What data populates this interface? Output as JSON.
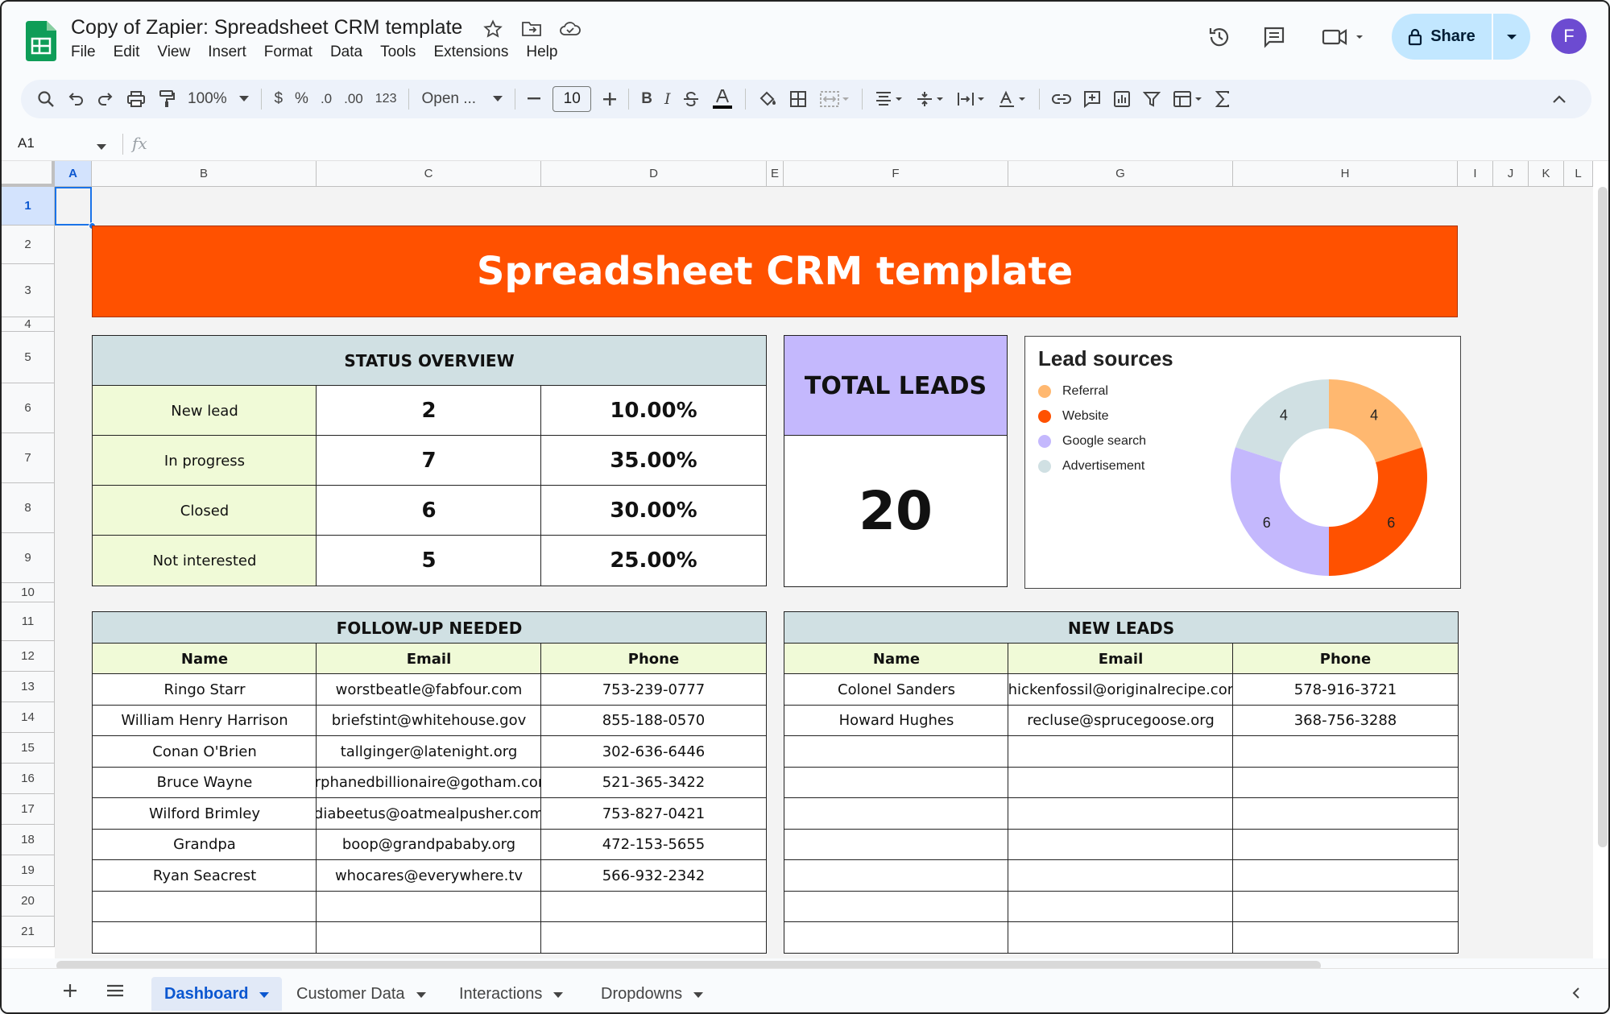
{
  "app": {
    "doc_title": "Copy of Zapier: Spreadsheet CRM template",
    "menu": [
      "File",
      "Edit",
      "View",
      "Insert",
      "Format",
      "Data",
      "Tools",
      "Extensions",
      "Help"
    ],
    "share_label": "Share",
    "avatar_letter": "F"
  },
  "toolbar": {
    "zoom": "100%",
    "currency": "$",
    "percent": "%",
    "dec_decrease": ".0",
    "dec_increase": ".00",
    "number_format": "123",
    "font": "Open ...",
    "font_size": "10",
    "bold": "B",
    "italic": "I"
  },
  "formula_bar": {
    "cell_ref": "A1",
    "fx": "fx",
    "content": ""
  },
  "columns": [
    "A",
    "B",
    "C",
    "D",
    "E",
    "F",
    "G",
    "H",
    "I",
    "J",
    "K",
    "L"
  ],
  "rows": [
    "1",
    "2",
    "3",
    "4",
    "5",
    "6",
    "7",
    "8",
    "9",
    "10",
    "11",
    "12",
    "13",
    "14",
    "15",
    "16",
    "17",
    "18",
    "19",
    "20",
    "21"
  ],
  "sheet": {
    "banner": "Spreadsheet CRM template",
    "status_overview": {
      "title": "STATUS OVERVIEW",
      "rows": [
        {
          "label": "New lead",
          "count": "2",
          "pct": "10.00%"
        },
        {
          "label": "In progress",
          "count": "7",
          "pct": "35.00%"
        },
        {
          "label": "Closed",
          "count": "6",
          "pct": "30.00%"
        },
        {
          "label": "Not interested",
          "count": "5",
          "pct": "25.00%"
        }
      ]
    },
    "total_leads": {
      "title": "TOTAL LEADS",
      "value": "20"
    },
    "follow_up": {
      "title": "FOLLOW-UP NEEDED",
      "headers": [
        "Name",
        "Email",
        "Phone"
      ],
      "rows": [
        [
          "Ringo Starr",
          "worstbeatle@fabfour.com",
          "753-239-0777"
        ],
        [
          "William Henry Harrison",
          "briefstint@whitehouse.gov",
          "855-188-0570"
        ],
        [
          "Conan O'Brien",
          "tallginger@latenight.org",
          "302-636-6446"
        ],
        [
          "Bruce Wayne",
          "orphanedbillionaire@gotham.com",
          "521-365-3422"
        ],
        [
          "Wilford Brimley",
          "diabeetus@oatmealpusher.com",
          "753-827-0421"
        ],
        [
          "Grandpa",
          "boop@grandpababy.org",
          "472-153-5655"
        ],
        [
          "Ryan Seacrest",
          "whocares@everywhere.tv",
          "566-932-2342"
        ]
      ]
    },
    "new_leads": {
      "title": "NEW LEADS",
      "headers": [
        "Name",
        "Email",
        "Phone"
      ],
      "rows": [
        [
          "Colonel Sanders",
          "chickenfossil@originalrecipe.com",
          "578-916-3721"
        ],
        [
          "Howard Hughes",
          "recluse@sprucegoose.org",
          "368-756-3288"
        ]
      ]
    }
  },
  "chart_data": {
    "type": "pie",
    "title": "Lead sources",
    "donut": true,
    "categories": [
      "Referral",
      "Website",
      "Google search",
      "Advertisement"
    ],
    "values": [
      4,
      6,
      6,
      4
    ],
    "colors": [
      "#ffb870",
      "#ff5100",
      "#c4b8fd",
      "#d0e0e3"
    ],
    "legend_position": "left"
  },
  "tabs": [
    {
      "label": "Dashboard",
      "active": true
    },
    {
      "label": "Customer Data",
      "active": false
    },
    {
      "label": "Interactions",
      "active": false
    },
    {
      "label": "Dropdowns",
      "active": false
    }
  ]
}
